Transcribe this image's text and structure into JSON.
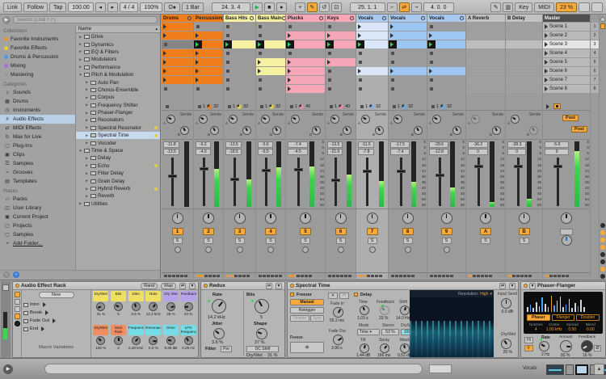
{
  "transport": {
    "link": "Link",
    "follow": "Follow",
    "tap": "Tap",
    "tempo": "100.00",
    "nudge_down": "◂",
    "nudge_up": "▸",
    "time_sig": "4 / 4",
    "groove_amount": "100%",
    "metronome": "O●",
    "quantize": "1 Bar",
    "arrangement_position": "24. 3. 4",
    "play": "▶",
    "stop": "■",
    "record": "●",
    "overdub": "+",
    "automation_arm": "✎",
    "reenable_automation": "↺",
    "capture_midi": "⊡",
    "session_record": "O",
    "loop_start": "25. 1. 1",
    "punch_in": "⌐",
    "loop": "⇄",
    "punch_out": "¬",
    "loop_length": "4. 0. 0",
    "draw_mode": "✎",
    "computer_midi_keyboard": "▥",
    "key_label": "Key",
    "midi_label": "MIDI",
    "cpu": "23 %"
  },
  "browser": {
    "search_placeholder": "Search (Cmd + F)",
    "sections": {
      "collections": "Collections",
      "categories": "Categories",
      "places": "Places"
    },
    "collections": [
      {
        "label": "Favorite Instruments",
        "color": "#e8972e"
      },
      {
        "label": "Favorite Effects",
        "color": "#e3cf3c"
      },
      {
        "label": "Drums & Percussion",
        "color": "#4a9de8"
      },
      {
        "label": "Mixing",
        "color": "#a66de0"
      },
      {
        "label": "Mastering",
        "color": "#9b9b9b"
      }
    ],
    "categories": [
      {
        "label": "Sounds",
        "glyph": "♫"
      },
      {
        "label": "Drums",
        "glyph": "▦"
      },
      {
        "label": "Instruments",
        "glyph": "◷"
      },
      {
        "label": "Audio Effects",
        "glyph": "#",
        "selected": true
      },
      {
        "label": "MIDI Effects",
        "glyph": "⇄"
      },
      {
        "label": "Max for Live",
        "glyph": "↻"
      },
      {
        "label": "Plug-Ins",
        "glyph": "▢"
      },
      {
        "label": "Clips",
        "glyph": "▣"
      },
      {
        "label": "Samples",
        "glyph": "☰"
      },
      {
        "label": "Grooves",
        "glyph": "≈"
      },
      {
        "label": "Templates",
        "glyph": "▤"
      }
    ],
    "places": [
      {
        "label": "Packs",
        "glyph": "▱"
      },
      {
        "label": "User Library",
        "glyph": "◫"
      },
      {
        "label": "Current Project",
        "glyph": "▣"
      },
      {
        "label": "Projects",
        "glyph": "▢"
      },
      {
        "label": "Samples",
        "glyph": "▢"
      },
      {
        "label": "Add Folder...",
        "glyph": "+",
        "underline": true
      }
    ],
    "tree_header": "Name",
    "tree": [
      {
        "label": "Drive",
        "depth": 0,
        "arrow": "▸"
      },
      {
        "label": "Dynamics",
        "depth": 0,
        "arrow": "▸"
      },
      {
        "label": "EQ & Filters",
        "depth": 0,
        "arrow": "▸"
      },
      {
        "label": "Modulators",
        "depth": 0,
        "arrow": "▸"
      },
      {
        "label": "Performance",
        "depth": 0,
        "arrow": "▸"
      },
      {
        "label": "Pitch & Modulation",
        "depth": 0,
        "arrow": "▾"
      },
      {
        "label": "Auto Pan",
        "depth": 1,
        "arrow": "▸",
        "device": true
      },
      {
        "label": "Chorus-Ensemble",
        "depth": 1,
        "arrow": "▸",
        "device": true
      },
      {
        "label": "Corpus",
        "depth": 1,
        "arrow": "▸",
        "device": true
      },
      {
        "label": "Frequency Shifter",
        "depth": 1,
        "arrow": "▸",
        "device": true
      },
      {
        "label": "Phaser-Flanger",
        "depth": 1,
        "arrow": "▸",
        "device": true
      },
      {
        "label": "Resonators",
        "depth": 1,
        "arrow": "▸",
        "device": true
      },
      {
        "label": "Spectral Resonator",
        "depth": 1,
        "arrow": "▸",
        "device": true,
        "dot": true
      },
      {
        "label": "Spectral Time",
        "depth": 1,
        "arrow": "▸",
        "device": true,
        "dot": true,
        "selected": true
      },
      {
        "label": "Vocoder",
        "depth": 1,
        "arrow": "▸",
        "device": true
      },
      {
        "label": "Time & Space",
        "depth": 0,
        "arrow": "▾"
      },
      {
        "label": "Delay",
        "depth": 1,
        "arrow": "▸",
        "device": true
      },
      {
        "label": "Echo",
        "depth": 1,
        "arrow": "▸",
        "device": true,
        "dot": true
      },
      {
        "label": "Filter Delay",
        "depth": 1,
        "arrow": "▸",
        "device": true
      },
      {
        "label": "Grain Delay",
        "depth": 1,
        "arrow": "▸",
        "device": true
      },
      {
        "label": "Hybrid Reverb",
        "depth": 1,
        "arrow": "▸",
        "device": true,
        "dot": true
      },
      {
        "label": "Reverb",
        "depth": 1,
        "arrow": "▸",
        "device": true
      },
      {
        "label": "Utilities",
        "depth": 0,
        "arrow": "▸"
      }
    ]
  },
  "session": {
    "sends_label": "Sends",
    "post_label": "Post",
    "solo_label": "S",
    "active_scene_index": 2,
    "scenes": [
      "Scene 1",
      "Scene 2",
      "Scene 3",
      "Scene 4",
      "Scene 5",
      "Scene 6",
      "Scene 7",
      "Scene 8"
    ],
    "scene_numbers": [
      "1",
      "2",
      "3",
      "4",
      "5",
      "6",
      "7",
      "8"
    ],
    "db_scale": [
      "6",
      "0",
      "6",
      "12",
      "18",
      "24",
      "30",
      "36",
      "42",
      "48",
      "54",
      "60"
    ],
    "mixer_toggles": [
      "off",
      "on",
      "on",
      "on",
      "off",
      "off",
      "on"
    ],
    "tracks": [
      {
        "name": "Drums",
        "kind": "audio",
        "color": "#ee7d1a",
        "clip_color": "#ee7d1a",
        "clips": [
          "clip",
          "clip",
          "stop",
          "clip",
          "clip",
          "clip",
          "clip",
          "stop"
        ],
        "status": null,
        "sends": {
          "a": true,
          "b": true
        },
        "peak": "-11.8",
        "vol": "-13.5",
        "fader": 0.62,
        "meter": 0.0,
        "num": "1",
        "mm": 0,
        "scale": false
      },
      {
        "name": "Percussion",
        "kind": "audio",
        "color": "#ee7d1a",
        "clip_color": "#ee7d1a",
        "clips": [
          "stop",
          "clip",
          "play",
          "clip",
          "clip",
          "clip",
          "clip",
          "stop"
        ],
        "status": {
          "bar": "1",
          "len": "32",
          "pie": "#ee7d1a"
        },
        "sends": {
          "a": true,
          "b": true
        },
        "peak": "-6.2",
        "vol": "-4.0",
        "fader": 0.78,
        "meter": 0.58,
        "num": "2",
        "mm": 2,
        "scale": false
      },
      {
        "name": "Bass Hits",
        "kind": "audio",
        "color": "#f6f1a1",
        "clip_color": "#f6f1a1",
        "clips": [
          "stop",
          "stop",
          "play",
          "stop",
          "stop",
          "stop",
          "stop",
          "stop"
        ],
        "status": {
          "bar": "1",
          "len": "32",
          "pie": "#d8cc50"
        },
        "sends": {
          "a": true,
          "b": true
        },
        "peak": "-13.5",
        "vol": "-18.5",
        "fader": 0.55,
        "meter": 0.42,
        "num": "3",
        "mm": 2,
        "scale": false
      },
      {
        "name": "Bass Main",
        "kind": "audio",
        "color": "#f6f1a1",
        "clip_color": "#f6f1a1",
        "clips": [
          "stop",
          "stop",
          "play",
          "stop",
          "clip",
          "clip",
          "stop",
          "stop"
        ],
        "status": {
          "bar": "1",
          "len": "32",
          "pie": "#d8cc50"
        },
        "sends": {
          "a": true,
          "b": true
        },
        "peak": "-5.6",
        "vol": "-6.5",
        "fader": 0.74,
        "meter": 0.6,
        "num": "4",
        "mm": 0,
        "scale": false
      },
      {
        "name": "Plucks",
        "kind": "audio",
        "color": "#f7a6b8",
        "clip_color": "#f7a6b8",
        "clips": [
          "stop",
          "clip",
          "play",
          "stop",
          "clip",
          "clip",
          "clip",
          "clip"
        ],
        "status": {
          "bar": "1",
          "len": "40",
          "pie": "#ef86a8"
        },
        "sends": {
          "a": true,
          "b": true
        },
        "peak": "-7.4",
        "vol": "-4.5",
        "fader": 0.77,
        "meter": 0.62,
        "num": "5",
        "mm": 2,
        "scale": true
      },
      {
        "name": "Keys",
        "kind": "audio",
        "color": "#f7a6b8",
        "clip_color": "#f7a6b8",
        "clips": [
          "stop",
          "clip",
          "play",
          "stop",
          "clip",
          "stop",
          "stop",
          "stop"
        ],
        "status": {
          "bar": "1",
          "len": "40",
          "pie": "#ef86a8"
        },
        "sends": {
          "a": true,
          "b": true
        },
        "peak": "-13.5",
        "vol": "-21.0",
        "fader": 0.52,
        "meter": 0.5,
        "num": "6",
        "mm": 0,
        "scale": false
      },
      {
        "name": "Vocals",
        "kind": "audio",
        "color": "#a9c9f1",
        "clip_color": "#d9e7f8",
        "clips": [
          "clip",
          "clip",
          "play",
          "stop",
          "stop",
          "clip",
          "stop",
          "stop"
        ],
        "status": {
          "bar": "1",
          "len": "32",
          "pie": "#7fb2e8"
        },
        "sends": {
          "a": true,
          "b": true
        },
        "peak": "-11.5",
        "vol": "-7.8",
        "fader": 0.72,
        "meter": 0.4,
        "num": "7",
        "mm": 2,
        "scale": false,
        "selected": true
      },
      {
        "name": "Vocals",
        "kind": "audio",
        "color": "#a9c9f1",
        "clip_color": "#9cc7f2",
        "clips": [
          "clip",
          "clip",
          "play",
          "stop",
          "stop",
          "clip",
          "stop",
          "stop"
        ],
        "status": {
          "bar": "1",
          "len": "32",
          "pie": "#6aa8e8"
        },
        "sends": {
          "a": true,
          "b": true
        },
        "peak": "-17.5",
        "vol": "-7.4",
        "fader": 0.72,
        "meter": 0.38,
        "num": "8",
        "mm": 0,
        "scale": true
      },
      {
        "name": "Vocals",
        "kind": "audio",
        "color": "#a9c9f1",
        "clip_color": "#9cc7f2",
        "clips": [
          "stop",
          "clip",
          "play",
          "stop",
          "stop",
          "clip",
          "stop",
          "stop"
        ],
        "status": {
          "bar": "1",
          "len": "32",
          "pie": "#6aa8e8"
        },
        "sends": {
          "a": true,
          "b": true
        },
        "peak": "-28.6",
        "vol": "-12.8",
        "fader": 0.64,
        "meter": 0.3,
        "num": "9",
        "mm": 0,
        "scale": true
      },
      {
        "name": "A Reverb",
        "kind": "return",
        "color": "#c2c2c2",
        "clips": [],
        "status": null,
        "sends": {
          "a": false,
          "b": true
        },
        "peak": "-36.2",
        "vol": "0",
        "fader": 0.83,
        "meter": 0.08,
        "num": "A",
        "mm": 1,
        "scale": true
      },
      {
        "name": "B Delay",
        "kind": "return",
        "color": "#c2c2c2",
        "clips": [],
        "status": null,
        "sends": {
          "a": true,
          "b": false
        },
        "peak": "-28.3",
        "vol": "0",
        "fader": 0.83,
        "meter": 0.12,
        "num": "B",
        "mm": 1,
        "scale": true
      },
      {
        "name": "Master",
        "kind": "master",
        "color": "#4f4f4f",
        "clips": [],
        "status": null,
        "peak": "-5.0",
        "vol": "0",
        "fader": 0.83,
        "meter": 0.85,
        "num": "",
        "mm": 1,
        "scale": true
      }
    ]
  },
  "devices": {
    "rack": {
      "title": "Audio Effect Rack",
      "rand_label": "Rand",
      "map_label": "Map",
      "new_label": "New",
      "variations_label": "Macro Variations",
      "variations": [
        "Intro",
        "Break",
        "Fade Out",
        "End"
      ],
      "macros": [
        {
          "label": "Dry/Wet",
          "value": "31 %",
          "color": "#efe063"
        },
        {
          "label": "Bits",
          "value": "5",
          "color": "#efe063"
        },
        {
          "label": "Jitter",
          "value": "3.6 %",
          "color": "#efe063"
        },
        {
          "label": "Rate",
          "value": "14.2 kHz",
          "color": "#efe063"
        },
        {
          "label": "Dry Wet",
          "value": "28 %",
          "color": "#b7a3ea"
        },
        {
          "label": "Feedback",
          "value": "23 %",
          "color": "#b7a3ea"
        },
        {
          "label": "Dry/Wet",
          "value": "100 %",
          "color": "#f08c62"
        },
        {
          "label": "Mod Rate",
          "value": "2",
          "color": "#f08c62"
        },
        {
          "label": "Frequency",
          "value": "6.30 kHz",
          "color": "#74dde8"
        },
        {
          "label": "Resonance",
          "value": "0.0 %",
          "color": "#74dde8"
        },
        {
          "label": "Drive",
          "value": "8.69 dB",
          "color": "#74dde8"
        },
        {
          "label": "LFO Frequency",
          "value": "0.28 Hz",
          "color": "#74dde8"
        }
      ]
    },
    "redux": {
      "title": "Redux",
      "rate_label": "Rate",
      "rate": "14.2 kHz",
      "jitter_label": "Jitter",
      "jitter": "3.6 %",
      "bits_label": "Bits",
      "bits": "5",
      "shape_label": "Shape",
      "shape": "27 %",
      "filter_label": "Filter",
      "pre_label": "Pre",
      "post_label": "Post",
      "filter_value": "0.00",
      "dc_shift_label": "DC Shift",
      "drywet_label": "Dry/Wet",
      "drywet": "31 %"
    },
    "spectral": {
      "title": "Spectral Time",
      "freezer_label": "Freezer",
      "manual_label": "Manual",
      "retrigger_label": "Retrigger",
      "onsets_label": "Onsets",
      "sync_label": "Sync",
      "fade_in_label": "Fade In",
      "fade_in": "55.2 ms",
      "fade_out_label": "Fade Out",
      "fade_out": "3.90 s",
      "freeze_label": "Freeze",
      "freeze_button": "✳",
      "delay_label": "Delay",
      "time_label": "Time",
      "time": "1.03 s",
      "feedback_label": "Feedback",
      "feedback": "23 %",
      "shift_label": "Shift",
      "shift": "14.0 Hz",
      "mode_label": "Mode",
      "mode": "Time",
      "stereo_label": "Stereo",
      "stereo": "53 %",
      "drywet_label": "Dry/Wet",
      "drywet": "100 %",
      "tilt_label": "Tilt",
      "tilt": "1.44 dB",
      "spray_label": "Spray",
      "spray": "166 ms",
      "mask_label": "Mask",
      "mask": "0.52 dB",
      "resolution_label": "Resolution:",
      "resolution": "High",
      "input_send_label": "Input Send",
      "input_send": "0.0 dB",
      "global_drywet_label": "Dry/Wet",
      "global_drywet": "26 %"
    },
    "phaser": {
      "title": "Phaser-Flanger",
      "tabs": [
        "Phaser",
        "Flanger",
        "Doubler"
      ],
      "notches_label": "Notches",
      "notches": "4",
      "center_label": "Center",
      "center": "1.00 kHz",
      "spread_label": "Spread",
      "spread": "0.50",
      "blend_label": "Blend",
      "blend": "0.00",
      "hi_label": "Hi",
      "f_label": "F",
      "rate_label": "Rate",
      "rate": "2 Hz",
      "amount_label": "Amount",
      "amount": "83 %",
      "feedback_label": "Feedback",
      "feedback": "16 %",
      "invert_label": "Ø"
    }
  },
  "status_bar": {
    "selected_track": "Vocals"
  }
}
